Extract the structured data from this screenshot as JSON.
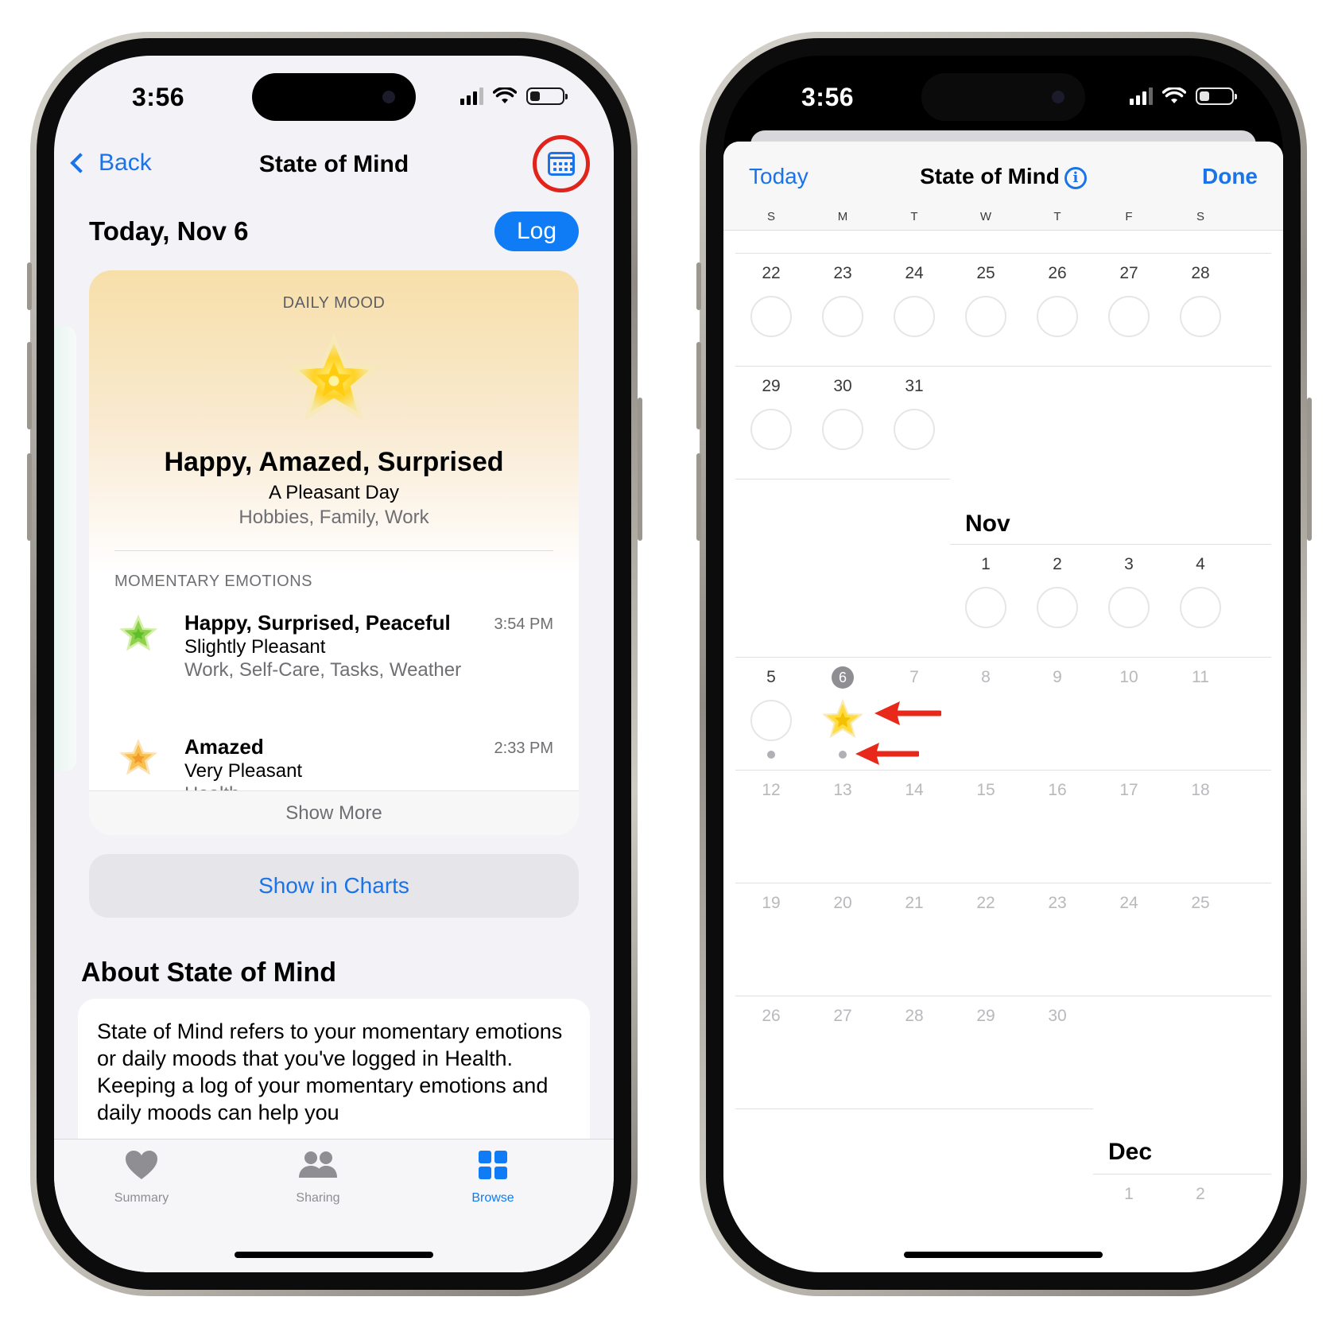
{
  "left_phone": {
    "status": {
      "time": "3:56"
    },
    "nav": {
      "back_label": "Back",
      "title": "State of Mind"
    },
    "date_header": {
      "date": "Today, Nov 6",
      "log_label": "Log"
    },
    "mood_card": {
      "kicker": "DAILY MOOD",
      "title": "Happy, Amazed, Surprised",
      "subtitle": "A Pleasant Day",
      "tags": "Hobbies, Family, Work",
      "momentary_kicker": "MOMENTARY EMOTIONS",
      "emotions": [
        {
          "title": "Happy, Surprised, Peaceful",
          "valence": "Slightly Pleasant",
          "tags": "Work, Self-Care, Tasks, Weather",
          "time": "3:54 PM",
          "color": "#8fd14f"
        },
        {
          "title": "Amazed",
          "valence": "Very Pleasant",
          "tags": "Health",
          "time": "2:33 PM",
          "color": "#f6b94a"
        }
      ],
      "show_more": "Show More"
    },
    "charts_button": "Show in Charts",
    "about": {
      "heading": "About State of Mind",
      "body": "State of Mind refers to your momentary emotions or daily moods that you've logged in Health. Keeping a log of your momentary emotions and daily moods can help you"
    },
    "tabs": [
      {
        "label": "Summary",
        "icon": "heart-icon"
      },
      {
        "label": "Sharing",
        "icon": "people-icon"
      },
      {
        "label": "Browse",
        "icon": "grid-icon"
      }
    ],
    "colors": {
      "accent": "#0f7bf4",
      "highlight_ring": "#e0241b"
    }
  },
  "right_phone": {
    "status": {
      "time": "3:56"
    },
    "sheet": {
      "today_label": "Today",
      "title": "State of Mind",
      "done_label": "Done",
      "info_glyph": "i"
    },
    "weekdays": [
      "S",
      "M",
      "T",
      "W",
      "T",
      "F",
      "S"
    ],
    "calendar": {
      "oct_week1": [
        "22",
        "23",
        "24",
        "25",
        "26",
        "27",
        "28"
      ],
      "oct_week2": [
        "29",
        "30",
        "31"
      ],
      "nov_label": "Nov",
      "nov_week1": [
        "1",
        "2",
        "3",
        "4"
      ],
      "nov_week2": [
        "5",
        "6",
        "7",
        "8",
        "9",
        "10",
        "11"
      ],
      "nov_week3": [
        "12",
        "13",
        "14",
        "15",
        "16",
        "17",
        "18"
      ],
      "nov_week4": [
        "19",
        "20",
        "21",
        "22",
        "23",
        "24",
        "25"
      ],
      "nov_week5": [
        "26",
        "27",
        "28",
        "29",
        "30"
      ],
      "dec_label": "Dec",
      "dec_week1": [
        "1",
        "2"
      ]
    },
    "colors": {
      "arrow": "#e8281b",
      "accent": "#1a73e8"
    }
  }
}
